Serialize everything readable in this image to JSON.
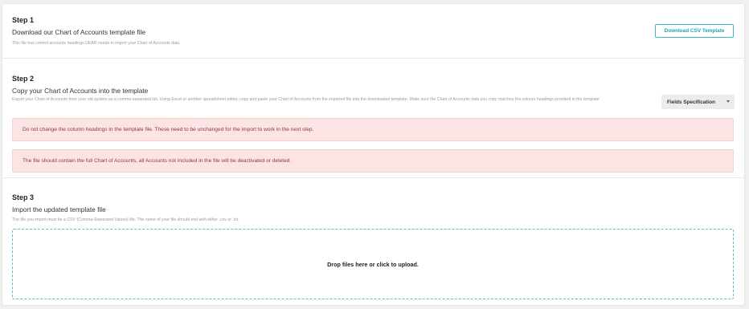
{
  "step1": {
    "title": "Step 1",
    "subtitle": "Download our Chart of Accounts template file",
    "hint": "This file has correct accounts headings DEAR needs to import your Chart of Accounts data.",
    "download_button": "Download CSV Template"
  },
  "step2": {
    "title": "Step 2",
    "subtitle": "Copy your Chart of Accounts into the template",
    "hint": "Export your Chart of Accounts from your old system as a comma-separated list. Using Excel or another spreadsheet editor, copy and paste your Chart of Accounts from the exported file into the downloaded template. Make sure the Chart of Accounts data you copy matches the column headings provided in the template",
    "dropdown_label": "Fields Specification",
    "alerts": [
      "Do not change the column headings in the template file. These need to be unchanged for the import to work in the next step.",
      "The file should contain the full Chart of Accounts, all Accounts not included in the file will be deactivated or deleted."
    ]
  },
  "step3": {
    "title": "Step 3",
    "subtitle": "Import the updated template file",
    "hint": "The file you import must be a CSV (Comma-Separated Values) file. The name of your file should end with either .csv or .txt.",
    "dropzone_text": "Drop files here or click to upload."
  },
  "colors": {
    "accent": "#1fa3b0",
    "alert_bg": "#fce4e4",
    "alert_text": "#8a3b3b"
  },
  "icons": {
    "dropdown": "chevron-down-icon"
  }
}
